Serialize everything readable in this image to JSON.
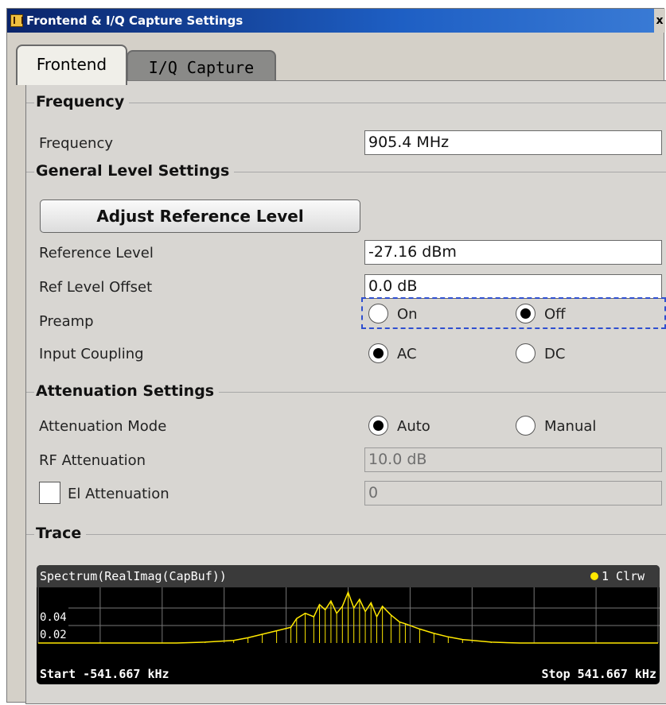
{
  "window": {
    "title": "Frontend & I/Q Capture Settings",
    "close_label": "x"
  },
  "tabs": {
    "frontend": "Frontend",
    "iq_capture": "I/Q Capture"
  },
  "frequency": {
    "group_title": "Frequency",
    "label": "Frequency",
    "value": "905.4 MHz"
  },
  "level": {
    "group_title": "General Level Settings",
    "adjust_button": "Adjust Reference Level",
    "ref_level_label": "Reference Level",
    "ref_level_value": "-27.16 dBm",
    "ref_offset_label": "Ref Level Offset",
    "ref_offset_value": "0.0 dB",
    "preamp_label": "Preamp",
    "preamp_on": "On",
    "preamp_off": "Off",
    "preamp_selected": "Off",
    "coupling_label": "Input Coupling",
    "coupling_ac": "AC",
    "coupling_dc": "DC",
    "coupling_selected": "AC"
  },
  "attenuation": {
    "group_title": "Attenuation Settings",
    "mode_label": "Attenuation Mode",
    "mode_auto": "Auto",
    "mode_manual": "Manual",
    "mode_selected": "Auto",
    "rf_label": "RF Attenuation",
    "rf_value": "10.0 dB",
    "el_label": "El Attenuation",
    "el_value": "0",
    "el_checked": false
  },
  "trace": {
    "group_title": "Trace",
    "title": "Spectrum(RealImag(CapBuf))",
    "legend": "1 Clrw",
    "trace_color": "#ffe800",
    "start": "Start -541.667 kHz",
    "stop": "Stop 541.667 kHz",
    "ytick_top": "0.04",
    "ytick_bottom": "0.02"
  },
  "chart_data": {
    "type": "line",
    "xlim": [
      -541.667,
      541.667
    ],
    "ylim": [
      0,
      0.06
    ],
    "yticks": [
      0.02,
      0.04
    ],
    "grid": true,
    "series": [
      {
        "color": "#ffe800",
        "x": [
          -541.667,
          -400,
          -300,
          -250,
          -200,
          -175,
          -150,
          -125,
          -100,
          -90,
          -75,
          -60,
          -50,
          -40,
          -30,
          -20,
          -10,
          0,
          10,
          20,
          30,
          40,
          50,
          60,
          75,
          90,
          100,
          125,
          150,
          175,
          200,
          250,
          300,
          400,
          541.667
        ],
        "y": [
          0.0,
          0.0,
          0.0,
          0.001,
          0.003,
          0.006,
          0.01,
          0.014,
          0.018,
          0.028,
          0.034,
          0.03,
          0.044,
          0.038,
          0.048,
          0.034,
          0.042,
          0.058,
          0.04,
          0.05,
          0.036,
          0.046,
          0.03,
          0.042,
          0.032,
          0.024,
          0.022,
          0.016,
          0.011,
          0.007,
          0.004,
          0.001,
          0.0,
          0.0,
          0.0
        ]
      }
    ]
  }
}
